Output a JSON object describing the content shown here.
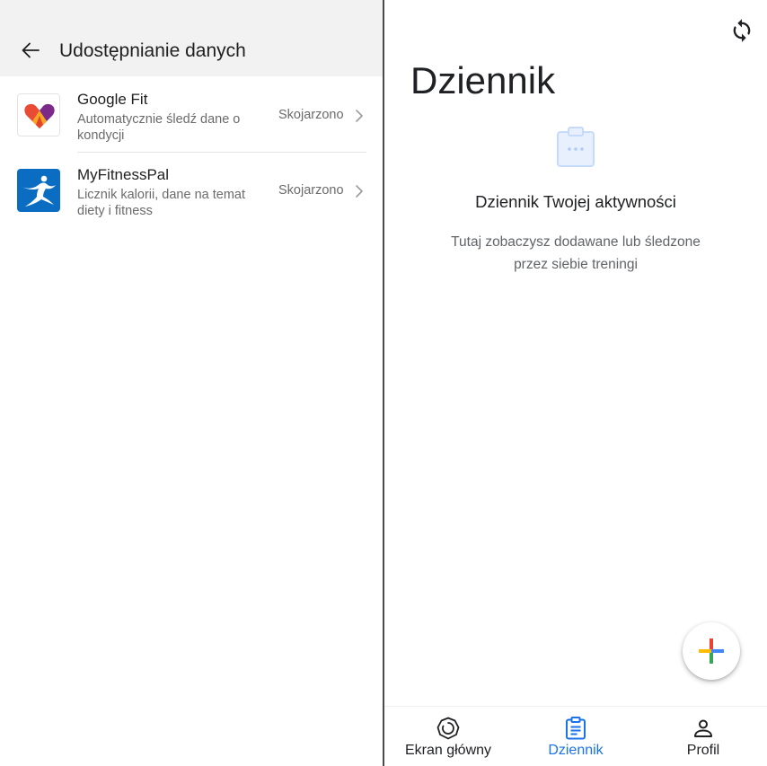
{
  "left_pane": {
    "title": "Udostępnianie danych",
    "apps": [
      {
        "name": "Google Fit",
        "description": "Automatycznie śledź dane o kondycji",
        "status": "Skojarzono",
        "icon": "google-fit-heart-logo"
      },
      {
        "name": "MyFitnessPal",
        "description": "Licznik kalorii, dane na temat diety i fitness",
        "status": "Skojarzono",
        "icon": "myfitnesspal-logo"
      }
    ]
  },
  "right_pane": {
    "title": "Dziennik",
    "empty_state": {
      "icon": "journal-clipboard-icon",
      "title": "Dziennik Twojej aktywności",
      "description": "Tutaj zobaczysz dodawane lub śledzone przez siebie treningi"
    },
    "fab_icon": "plus-icon",
    "nav": [
      {
        "label": "Ekran główny",
        "icon": "home-ring-icon",
        "active": false
      },
      {
        "label": "Dziennik",
        "icon": "journal-icon",
        "active": true
      },
      {
        "label": "Profil",
        "icon": "profile-icon",
        "active": false
      }
    ]
  },
  "colors": {
    "accent": "#1a73e8",
    "header_bg": "#f2f2f2",
    "secondary_text": "#6b6b6b"
  }
}
